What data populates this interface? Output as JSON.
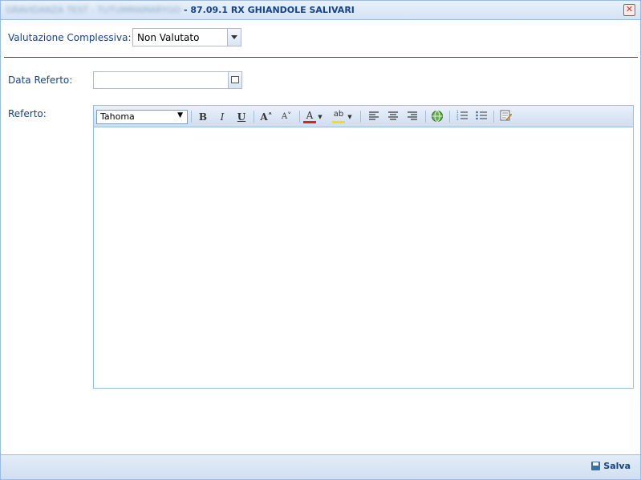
{
  "window": {
    "title_blurred": "GRAVIDANZA TEST - TUTUMMAMARYGO",
    "title_suffix": "- 87.09.1 RX GHIANDOLE SALIVARI"
  },
  "form": {
    "valutazione_label": "Valutazione Complessiva:",
    "valutazione_value": "Non Valutato",
    "data_label": "Data Referto:",
    "data_value": "",
    "referto_label": "Referto:"
  },
  "toolbar": {
    "font_value": "Tahoma",
    "bold": "B",
    "italic": "I",
    "underline": "U",
    "grow": "A˄",
    "shrink": "A˅",
    "color": "A",
    "highlight": "ab"
  },
  "footer": {
    "save_label": "Salva"
  },
  "colors": {
    "accent": "#15428b",
    "separator": "#7d2a3d",
    "border": "#99bbe8"
  }
}
